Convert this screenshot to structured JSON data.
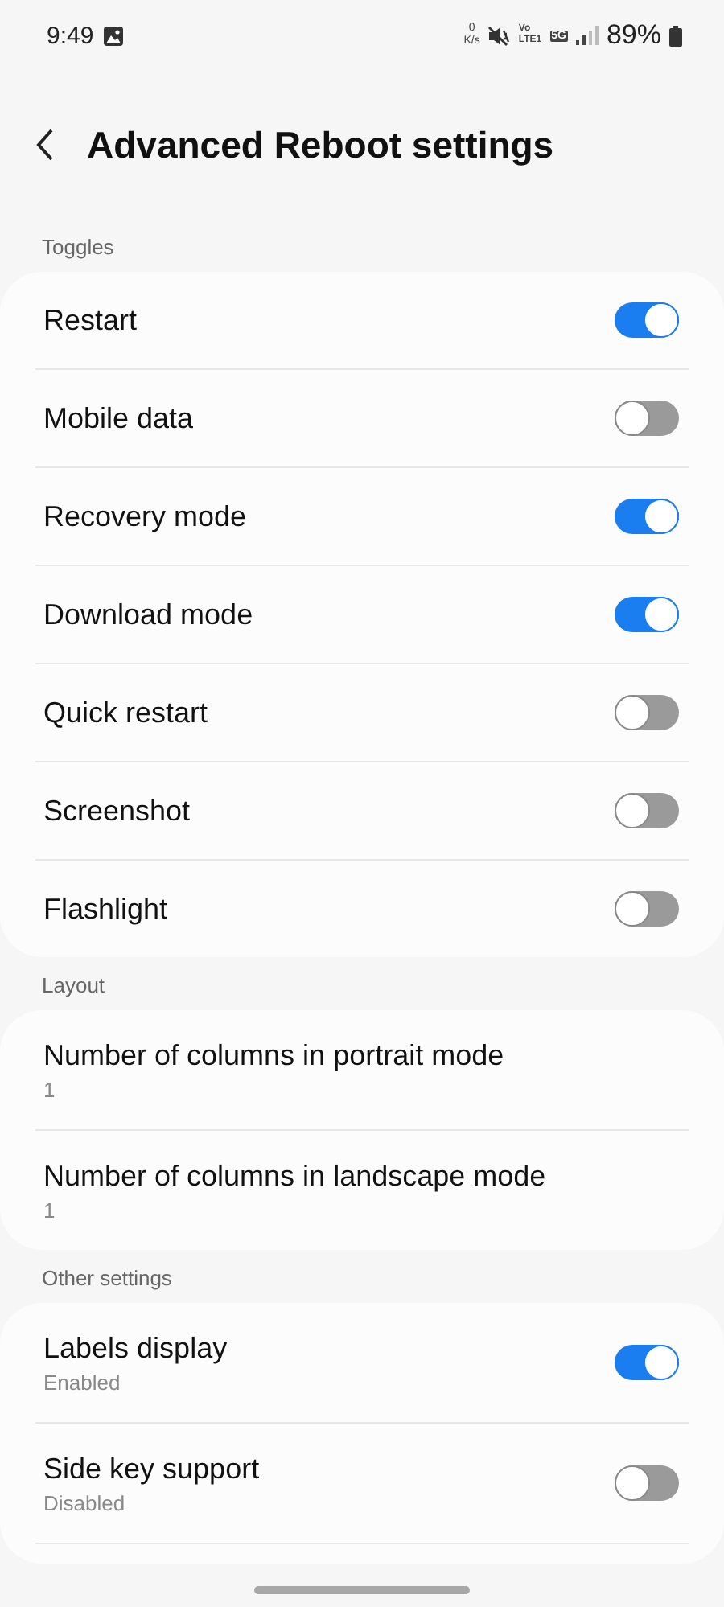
{
  "status_bar": {
    "time": "9:49",
    "net_speed_value": "0",
    "net_speed_unit": "K/s",
    "volte": "Vo",
    "volte_sub": "LTE1",
    "network": "5G",
    "battery": "89%"
  },
  "header": {
    "title": "Advanced Reboot settings"
  },
  "sections": [
    {
      "title": "Toggles",
      "rows": [
        {
          "kind": "switch",
          "title": "Restart",
          "on": true
        },
        {
          "kind": "switch",
          "title": "Mobile data",
          "on": false
        },
        {
          "kind": "switch",
          "title": "Recovery mode",
          "on": true
        },
        {
          "kind": "switch",
          "title": "Download mode",
          "on": true
        },
        {
          "kind": "switch",
          "title": "Quick restart",
          "on": false
        },
        {
          "kind": "switch",
          "title": "Screenshot",
          "on": false
        },
        {
          "kind": "switch",
          "title": "Flashlight",
          "on": false
        }
      ]
    },
    {
      "title": "Layout",
      "rows": [
        {
          "kind": "value",
          "title": "Number of columns in portrait mode",
          "summary": "1"
        },
        {
          "kind": "value",
          "title": "Number of columns in landscape mode",
          "summary": "1"
        }
      ]
    },
    {
      "title": "Other settings",
      "rows": [
        {
          "kind": "switch",
          "title": "Labels display",
          "summary": "Enabled",
          "on": true
        },
        {
          "kind": "switch",
          "title": "Side key support",
          "summary": "Disabled",
          "on": false
        }
      ]
    }
  ]
}
